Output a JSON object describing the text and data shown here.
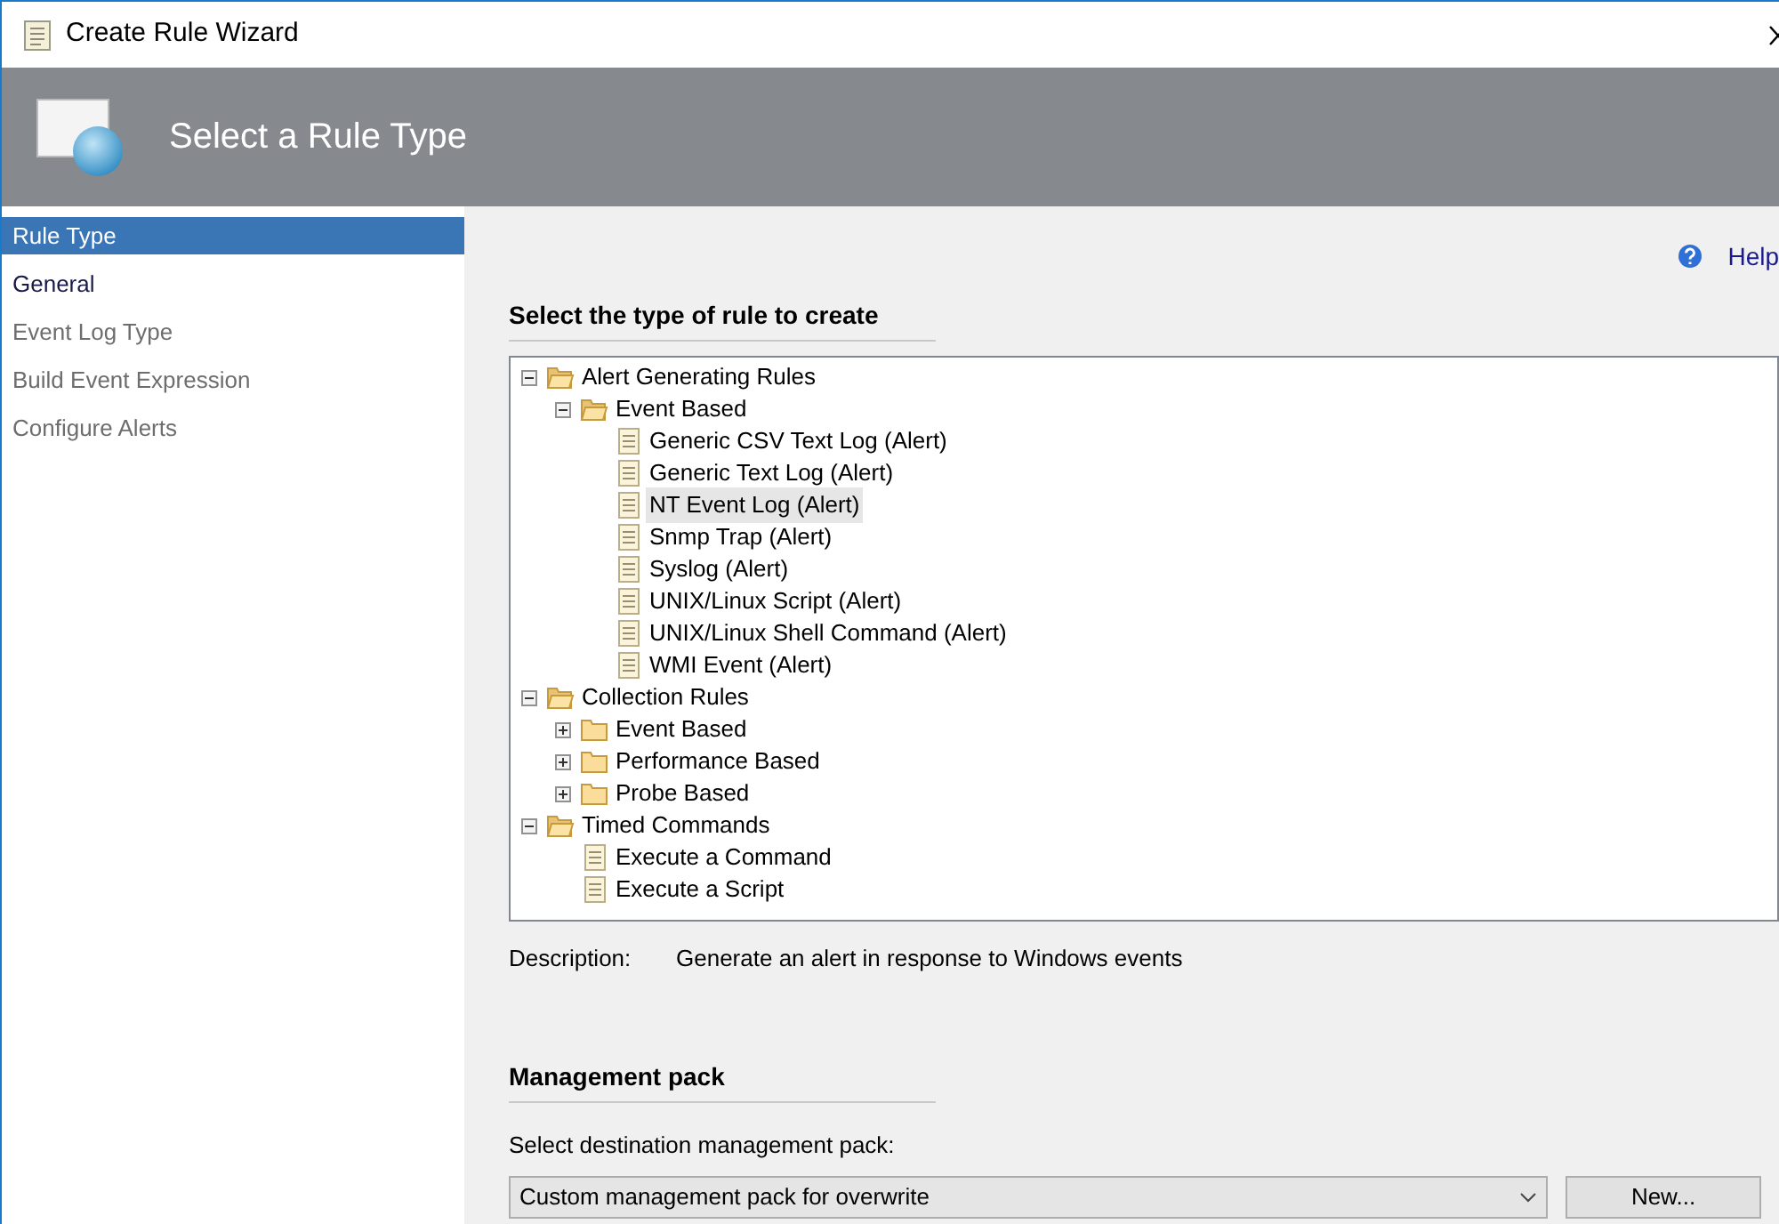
{
  "window": {
    "title": "Create Rule Wizard"
  },
  "header": {
    "title": "Select a Rule Type"
  },
  "sidebar": {
    "items": [
      {
        "label": "Rule Type",
        "selected": true,
        "enabled": true
      },
      {
        "label": "General",
        "selected": false,
        "enabled": true
      },
      {
        "label": "Event Log Type",
        "selected": false,
        "enabled": false
      },
      {
        "label": "Build Event Expression",
        "selected": false,
        "enabled": false
      },
      {
        "label": "Configure Alerts",
        "selected": false,
        "enabled": false
      }
    ]
  },
  "help": {
    "label": "Help"
  },
  "rule_type": {
    "heading": "Select the type of rule to create",
    "tree": [
      {
        "label": "Alert Generating Rules",
        "kind": "folder",
        "expanded": true,
        "selected": false,
        "children": [
          {
            "label": "Event Based",
            "kind": "folder",
            "expanded": true,
            "selected": false,
            "children": [
              {
                "label": "Generic CSV Text Log (Alert)",
                "kind": "rule",
                "selected": false
              },
              {
                "label": "Generic Text Log (Alert)",
                "kind": "rule",
                "selected": false
              },
              {
                "label": "NT Event Log (Alert)",
                "kind": "rule",
                "selected": true
              },
              {
                "label": "Snmp Trap (Alert)",
                "kind": "rule",
                "selected": false
              },
              {
                "label": "Syslog (Alert)",
                "kind": "rule",
                "selected": false
              },
              {
                "label": "UNIX/Linux Script (Alert)",
                "kind": "rule",
                "selected": false
              },
              {
                "label": "UNIX/Linux Shell Command (Alert)",
                "kind": "rule",
                "selected": false
              },
              {
                "label": "WMI Event (Alert)",
                "kind": "rule",
                "selected": false
              }
            ]
          }
        ]
      },
      {
        "label": "Collection Rules",
        "kind": "folder",
        "expanded": true,
        "selected": false,
        "children": [
          {
            "label": "Event Based",
            "kind": "folder",
            "expanded": false,
            "selected": false
          },
          {
            "label": "Performance Based",
            "kind": "folder",
            "expanded": false,
            "selected": false
          },
          {
            "label": "Probe Based",
            "kind": "folder",
            "expanded": false,
            "selected": false
          }
        ]
      },
      {
        "label": "Timed Commands",
        "kind": "folder",
        "expanded": true,
        "selected": false,
        "children": [
          {
            "label": "Execute a Command",
            "kind": "rule",
            "selected": false
          },
          {
            "label": "Execute a Script",
            "kind": "rule",
            "selected": false
          }
        ]
      }
    ],
    "description_label": "Description:",
    "description": "Generate an alert in response to Windows events"
  },
  "management_pack": {
    "heading": "Management pack",
    "label": "Select destination management pack:",
    "value": "Custom management pack for overwrite",
    "new_button": "New..."
  }
}
